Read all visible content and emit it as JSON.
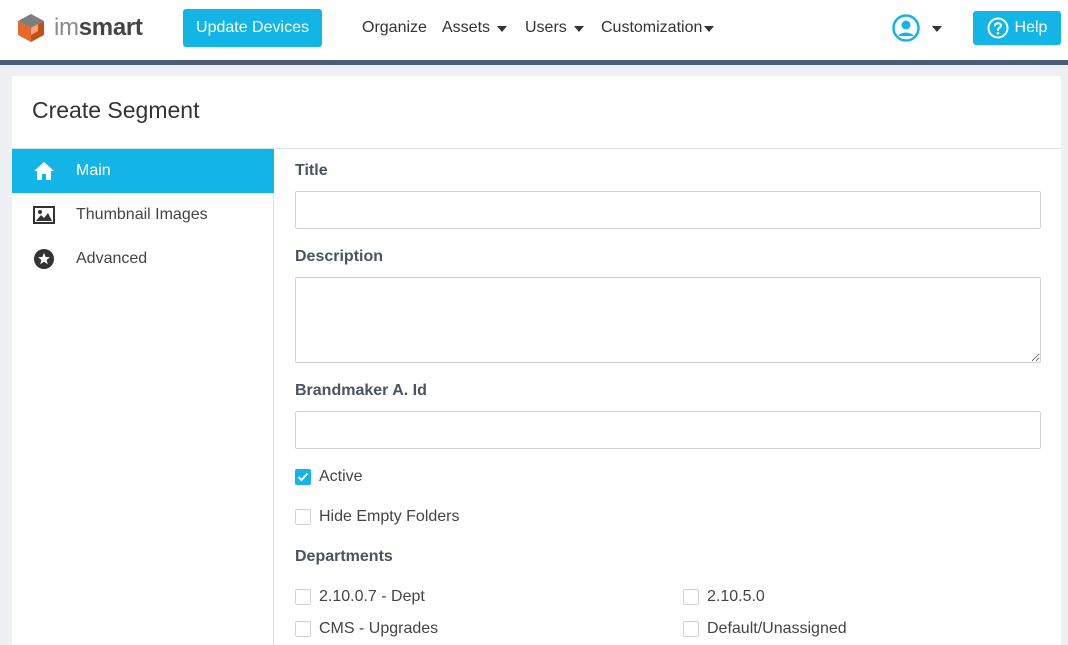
{
  "brand": {
    "name_prefix": "im",
    "name_suffix": "smart"
  },
  "navbar": {
    "update_button": "Update Devices",
    "menus": [
      "Organize",
      "Assets",
      "Users",
      "Customization"
    ],
    "help_button": "Help"
  },
  "page": {
    "title": "Create Segment"
  },
  "sidebar": {
    "items": [
      {
        "label": "Main",
        "icon": "home-icon",
        "active": true
      },
      {
        "label": "Thumbnail Images",
        "icon": "image-icon",
        "active": false
      },
      {
        "label": "Advanced",
        "icon": "star-circle-icon",
        "active": false
      }
    ]
  },
  "form": {
    "title_label": "Title",
    "title_value": "",
    "description_label": "Description",
    "description_value": "",
    "brandmaker_label": "Brandmaker A. Id",
    "brandmaker_value": "",
    "active_label": "Active",
    "active_checked": true,
    "hide_empty_label": "Hide Empty Folders",
    "hide_empty_checked": false,
    "departments_label": "Departments",
    "departments": [
      {
        "label": "2.10.0.7 - Dept",
        "checked": false
      },
      {
        "label": "2.10.5.0",
        "checked": false
      },
      {
        "label": "CMS - Upgrades",
        "checked": false
      },
      {
        "label": "Default/Unassigned",
        "checked": false
      }
    ]
  },
  "colors": {
    "accent": "#12b5e6",
    "navbar_rule": "#4e5d76",
    "logo_orange": "#e8672b"
  }
}
